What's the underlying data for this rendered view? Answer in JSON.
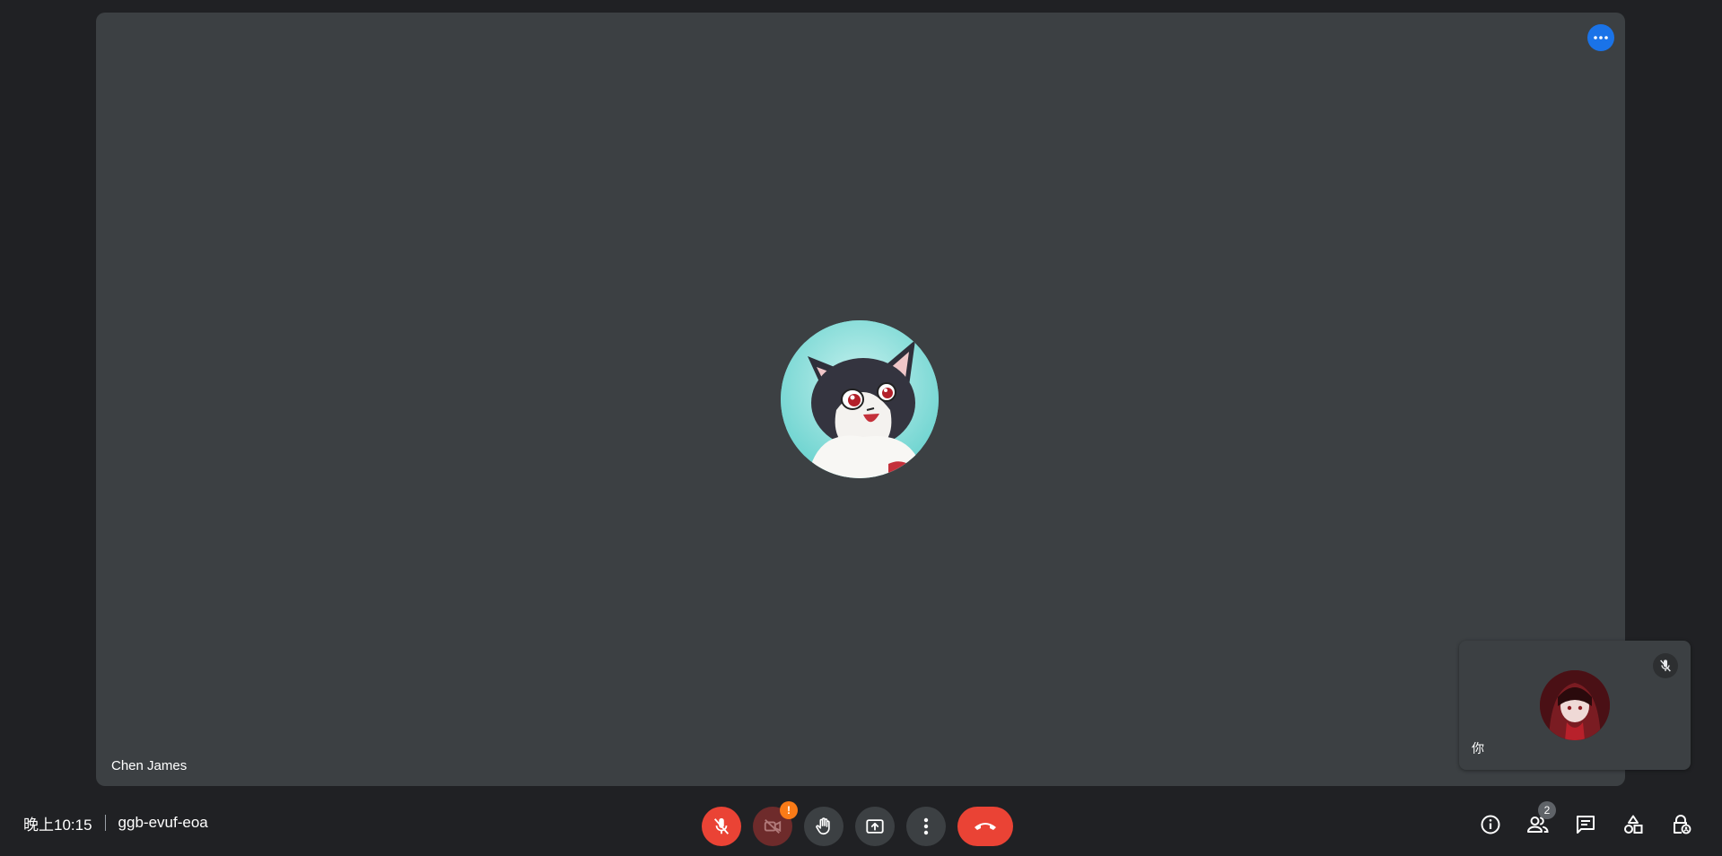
{
  "main_tile": {
    "participant_name": "Chen James",
    "more_icon": "more-horiz-icon",
    "accent_color": "#1a73e8"
  },
  "self_tile": {
    "label": "你",
    "mic_icon": "mic-off-icon"
  },
  "meeting": {
    "time": "晚上10:15",
    "code": "ggb-evuf-eoa"
  },
  "controls": {
    "mic_icon": "mic-off-icon",
    "camera_icon": "videocam-off-icon",
    "camera_warning": "!",
    "raise_hand_icon": "raise-hand-icon",
    "present_icon": "present-screen-icon",
    "more_icon": "more-vert-icon",
    "end_call_icon": "call-end-icon",
    "danger_color": "#ea4335",
    "warning_color": "#fa7b17"
  },
  "right_tools": {
    "info_icon": "info-icon",
    "people_icon": "people-icon",
    "people_count": "2",
    "chat_icon": "chat-icon",
    "activities_icon": "activities-icon",
    "host_controls_icon": "lock-person-icon"
  }
}
